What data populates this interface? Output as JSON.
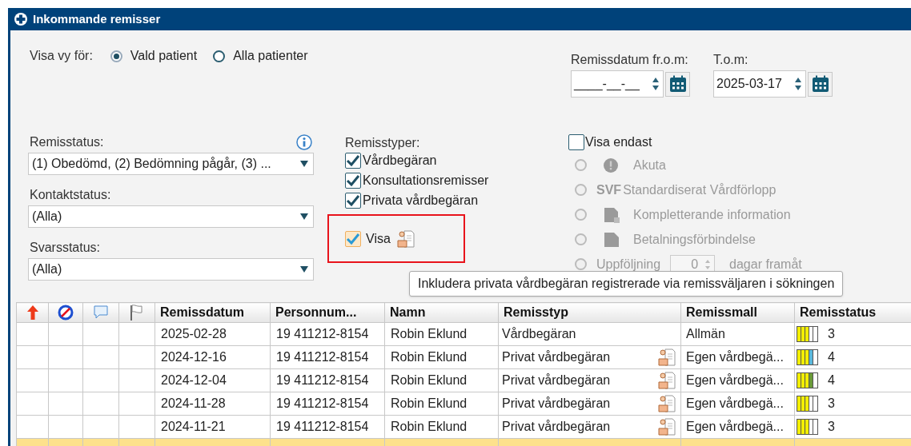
{
  "window": {
    "title": "Inkommande remisser"
  },
  "view_for": {
    "label": "Visa vy för:",
    "options": [
      {
        "label": "Vald patient",
        "selected": true
      },
      {
        "label": "Alla patienter",
        "selected": false
      }
    ]
  },
  "date_range": {
    "from_label": "Remissdatum fr.o.m:",
    "from_value": "____-__-__",
    "to_label": "T.o.m:",
    "to_value": "2025-03-17"
  },
  "filters": [
    {
      "label": "Remisstatus:",
      "value": "(1) Obedömd, (2) Bedömning pågår, (3) ...",
      "info": true
    },
    {
      "label": "Kontaktstatus:",
      "value": "(Alla)",
      "info": false
    },
    {
      "label": "Svarsstatus:",
      "value": "(Alla)",
      "info": false
    }
  ],
  "referral_types": {
    "label": "Remisstyper:",
    "items": [
      {
        "label": "Vårdbegäran",
        "checked": true
      },
      {
        "label": "Konsultationsremisser",
        "checked": true
      },
      {
        "label": "Privata vårdbegäran",
        "checked": true
      }
    ],
    "show": {
      "label": "Visa",
      "checked": true
    }
  },
  "show_only": {
    "label": "Visa endast",
    "checked": false,
    "items": [
      {
        "kind": "alert",
        "label": "Akuta",
        "selected": false,
        "disabled": true
      },
      {
        "kind": "prefix",
        "prefix": "SVF",
        "label": "Standardiserat Vårdförlopp",
        "selected": false,
        "disabled": true
      },
      {
        "kind": "query",
        "label": "Kompletterande information",
        "selected": false,
        "disabled": true
      },
      {
        "kind": "payment",
        "label": "Betalningsförbindelse",
        "selected": false,
        "disabled": true
      },
      {
        "kind": "followup",
        "label": "Uppföljning",
        "days": "0",
        "suffix": "dagar framåt",
        "selected": false,
        "disabled": true
      }
    ]
  },
  "tooltip": "Inkludera privata vårdbegäran registrerade via remissväljaren i sökningen",
  "table": {
    "columns": [
      "Remissdatum",
      "Personnum...",
      "Namn",
      "Remisstyp",
      "Remissmall",
      "Remisstatus"
    ],
    "rows": [
      {
        "selected": false,
        "date": "2025-02-28",
        "personnummer": "19 411212-8154",
        "name": "Robin Eklund",
        "type": "Vårdbegäran",
        "private_icon": false,
        "template": "Allmän",
        "status": "3",
        "status_segments": [
          {
            "color": "#f2ee00"
          },
          {
            "color": "#f2ee00"
          },
          {
            "color": "#f2ee00"
          },
          {
            "color": "#ffffff"
          },
          {
            "color": "#ffffff"
          }
        ]
      },
      {
        "selected": false,
        "date": "2024-12-16",
        "personnummer": "19 411212-8154",
        "name": "Robin Eklund",
        "type": "Privat vårdbegäran",
        "private_icon": true,
        "template": "Egen vårdbegä...",
        "status": "4",
        "status_segments": [
          {
            "color": "#f2ee00"
          },
          {
            "color": "#f2ee00"
          },
          {
            "color": "#f2ee00"
          },
          {
            "color": "#5bb8dc"
          },
          {
            "color": "#ffffff"
          }
        ]
      },
      {
        "selected": false,
        "date": "2024-12-04",
        "personnummer": "19 411212-8154",
        "name": "Robin Eklund",
        "type": "Privat vårdbegäran",
        "private_icon": true,
        "template": "Egen vårdbegä...",
        "status": "4",
        "status_segments": [
          {
            "color": "#f2ee00"
          },
          {
            "color": "#f2ee00"
          },
          {
            "color": "#f2ee00"
          },
          {
            "color": "#6a9a3a"
          },
          {
            "color": "#ffffff"
          }
        ]
      },
      {
        "selected": false,
        "date": "2024-11-28",
        "personnummer": "19 411212-8154",
        "name": "Robin Eklund",
        "type": "Privat vårdbegäran",
        "private_icon": true,
        "template": "Egen vårdbegä...",
        "status": "3",
        "status_segments": [
          {
            "color": "#f2ee00"
          },
          {
            "color": "#f2ee00"
          },
          {
            "color": "#f2ee00"
          },
          {
            "color": "#ffffff"
          },
          {
            "color": "#ffffff"
          }
        ]
      },
      {
        "selected": false,
        "date": "2024-11-21",
        "personnummer": "19 411212-8154",
        "name": "Robin Eklund",
        "type": "Privat vårdbegäran",
        "private_icon": true,
        "template": "Egen vårdbegä...",
        "status": "3",
        "status_segments": [
          {
            "color": "#f2ee00"
          },
          {
            "color": "#f2ee00"
          },
          {
            "color": "#f2ee00"
          },
          {
            "color": "#ffffff"
          },
          {
            "color": "#ffffff"
          }
        ]
      },
      {
        "selected": true
      }
    ]
  }
}
